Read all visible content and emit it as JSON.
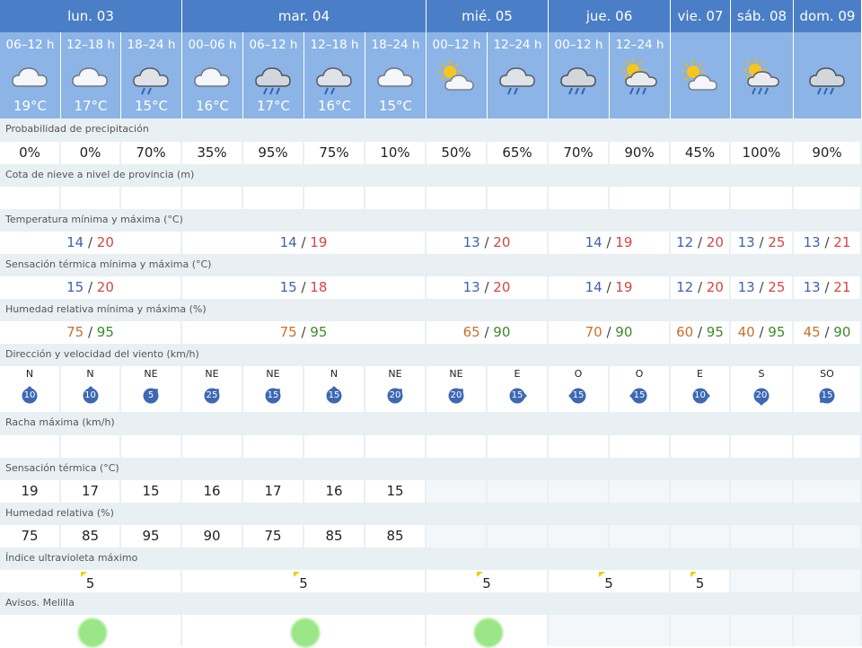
{
  "days": [
    {
      "label": "lun. 03",
      "span": 3
    },
    {
      "label": "mar. 04",
      "span": 4
    },
    {
      "label": "mié. 05",
      "span": 2
    },
    {
      "label": "jue. 06",
      "span": 2
    },
    {
      "label": "vie. 07",
      "span": 1
    },
    {
      "label": "sáb. 08",
      "span": 1
    },
    {
      "label": "dom. 09",
      "span": 1
    }
  ],
  "periods": [
    {
      "label": "06–12 h",
      "icon": "cloudy-icon",
      "temp": "19°C"
    },
    {
      "label": "12–18 h",
      "icon": "cloudy-icon",
      "temp": "17°C"
    },
    {
      "label": "18–24 h",
      "icon": "rain-cloud-icon",
      "temp": "15°C"
    },
    {
      "label": "00–06 h",
      "icon": "cloudy-icon",
      "temp": "16°C"
    },
    {
      "label": "06–12 h",
      "icon": "heavy-rain-cloud-icon",
      "temp": "17°C"
    },
    {
      "label": "12–18 h",
      "icon": "rain-cloud-icon",
      "temp": "16°C"
    },
    {
      "label": "18–24 h",
      "icon": "cloudy-icon",
      "temp": "15°C"
    },
    {
      "label": "00–12 h",
      "icon": "partly-cloudy-icon",
      "temp": ""
    },
    {
      "label": "12–24 h",
      "icon": "rain-cloud-icon",
      "temp": ""
    },
    {
      "label": "00–12 h",
      "icon": "heavy-rain-cloud-icon",
      "temp": ""
    },
    {
      "label": "12–24 h",
      "icon": "sun-rain-cloud-icon",
      "temp": ""
    },
    {
      "label": "",
      "icon": "partly-cloudy-icon",
      "temp": ""
    },
    {
      "label": "",
      "icon": "sun-rain-cloud-icon",
      "temp": ""
    },
    {
      "label": "",
      "icon": "heavy-rain-cloud-icon",
      "temp": ""
    }
  ],
  "rows": {
    "precip_label": "Probabilidad de precipitación",
    "precip": [
      "0%",
      "0%",
      "70%",
      "35%",
      "95%",
      "75%",
      "10%",
      "50%",
      "65%",
      "70%",
      "90%",
      "45%",
      "100%",
      "90%"
    ],
    "snow_label": "Cota de nieve a nivel de provincia (m)",
    "temp_label": "Temperatura mínima y máxima (°C)",
    "temp": [
      {
        "min": "14",
        "max": "20"
      },
      {
        "min": "14",
        "max": "19"
      },
      {
        "min": "13",
        "max": "20"
      },
      {
        "min": "14",
        "max": "19"
      },
      {
        "min": "12",
        "max": "20"
      },
      {
        "min": "13",
        "max": "25"
      },
      {
        "min": "13",
        "max": "21"
      }
    ],
    "feels_label": "Sensación térmica mínima y máxima (°C)",
    "feels": [
      {
        "min": "15",
        "max": "20"
      },
      {
        "min": "15",
        "max": "18"
      },
      {
        "min": "13",
        "max": "20"
      },
      {
        "min": "14",
        "max": "19"
      },
      {
        "min": "12",
        "max": "20"
      },
      {
        "min": "13",
        "max": "25"
      },
      {
        "min": "13",
        "max": "21"
      }
    ],
    "hum_label": "Humedad relativa mínima y máxima (%)",
    "hum": [
      {
        "min": "75",
        "max": "95"
      },
      {
        "min": "75",
        "max": "95"
      },
      {
        "min": "65",
        "max": "90"
      },
      {
        "min": "70",
        "max": "90"
      },
      {
        "min": "60",
        "max": "95"
      },
      {
        "min": "40",
        "max": "95"
      },
      {
        "min": "45",
        "max": "90"
      }
    ],
    "wind_label": "Dirección y velocidad del viento (km/h)",
    "wind": [
      {
        "dir": "N",
        "speed": "10"
      },
      {
        "dir": "N",
        "speed": "10"
      },
      {
        "dir": "NE",
        "speed": "5"
      },
      {
        "dir": "NE",
        "speed": "25"
      },
      {
        "dir": "NE",
        "speed": "15"
      },
      {
        "dir": "N",
        "speed": "15"
      },
      {
        "dir": "NE",
        "speed": "20"
      },
      {
        "dir": "NE",
        "speed": "20"
      },
      {
        "dir": "E",
        "speed": "15"
      },
      {
        "dir": "O",
        "speed": "15"
      },
      {
        "dir": "O",
        "speed": "15"
      },
      {
        "dir": "E",
        "speed": "10"
      },
      {
        "dir": "S",
        "speed": "20"
      },
      {
        "dir": "SO",
        "speed": "15"
      }
    ],
    "gust_label": "Racha máxima (km/h)",
    "feel_label": "Sensación térmica (°C)",
    "feel": [
      "19",
      "17",
      "15",
      "16",
      "17",
      "16",
      "15"
    ],
    "rh_label": "Humedad relativa (%)",
    "rh": [
      "75",
      "85",
      "95",
      "90",
      "75",
      "85",
      "85"
    ],
    "uv_label": "Índice ultravioleta máximo",
    "uv": [
      "5",
      "5",
      "5",
      "5",
      "5",
      null,
      null
    ],
    "alert_label": "Avisos. Melilla"
  },
  "colors": {
    "header_dark": "#4a7ec7",
    "header_light": "#8cb4e6",
    "row_label_bg": "#e9f0f4",
    "min_color": "#3d63b0",
    "max_color": "#d64543",
    "hum_min_color": "#c6712d",
    "hum_max_color": "#3c8b2a",
    "wind_badge": "#3d68b3",
    "uv_flag": "#e8d20a",
    "alert_green": "#9be787"
  }
}
